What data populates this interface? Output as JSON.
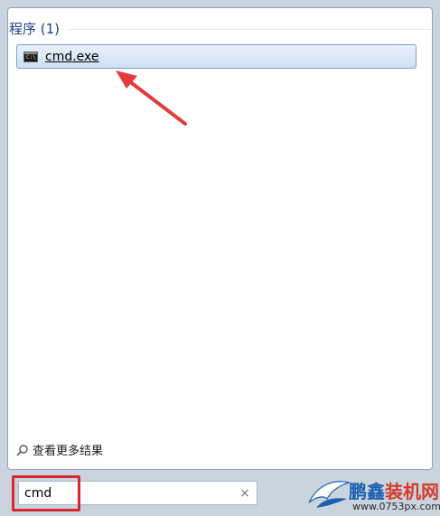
{
  "results": {
    "section_title": "程序 (1)",
    "items": [
      {
        "label": "cmd.exe",
        "icon": "command-prompt-icon"
      }
    ]
  },
  "see_more": {
    "label": "查看更多结果"
  },
  "search": {
    "value": "cmd",
    "clear_symbol": "×"
  },
  "watermark": {
    "title_part1": "鹏鑫",
    "title_part2": "装机网",
    "url": "www.0753px.com"
  },
  "colors": {
    "section_title": "#1e3f8a",
    "highlight": "#d6282e",
    "arrow": "#e23b3b",
    "selection": "#cfe0f3"
  }
}
